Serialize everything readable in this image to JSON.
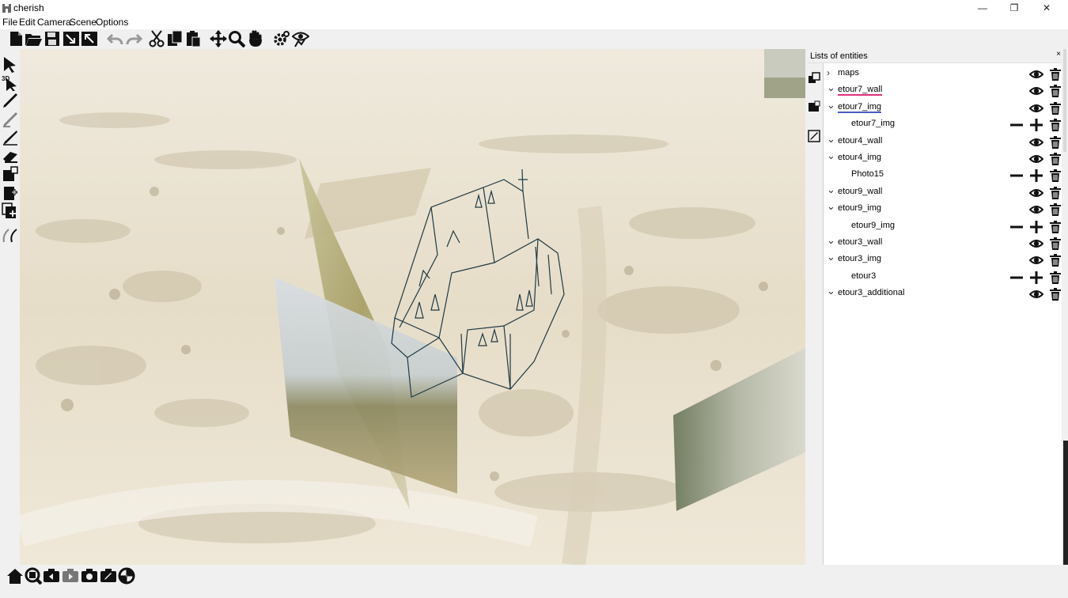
{
  "window": {
    "title": "cherish",
    "minimize": "—",
    "restore": "❐",
    "close": "✕"
  },
  "menu": [
    "File",
    "Edit",
    "Camera",
    "Scene",
    "Options"
  ],
  "toolbar_icons": [
    "new-file-icon",
    "open-folder-icon",
    "save-icon",
    "import-image-icon",
    "export-image-icon",
    "undo-icon",
    "redo-icon",
    "cut-icon",
    "copy-icon",
    "paste-icon",
    "move-icon",
    "zoom-icon",
    "pan-hand-icon",
    "settings-icon",
    "view-options-icon"
  ],
  "left_tools": [
    "select-arrow-icon",
    "select-3d-icon",
    "pen-icon",
    "pencil-faded-icon",
    "brush-icon",
    "eraser-icon",
    "add-canvas-icon",
    "new-canvas-icon",
    "clone-canvas-icon",
    "curve-icon"
  ],
  "panel": {
    "title": "Lists of entities",
    "close": "×",
    "entities": [
      {
        "name": "maps",
        "level": 0,
        "expanded": false,
        "visible": true,
        "deletable": true,
        "has_stepper": false,
        "underline": ""
      },
      {
        "name": "etour7_wall",
        "level": 0,
        "expanded": true,
        "visible": true,
        "deletable": true,
        "has_stepper": false,
        "underline": "#e0307a"
      },
      {
        "name": "etour7_img",
        "level": 0,
        "expanded": true,
        "visible": true,
        "deletable": true,
        "has_stepper": false,
        "underline": "#4a5cc8"
      },
      {
        "name": "etour7_img",
        "level": 1,
        "expanded": false,
        "visible": false,
        "deletable": true,
        "has_stepper": true,
        "underline": ""
      },
      {
        "name": "etour4_wall",
        "level": 0,
        "expanded": true,
        "visible": true,
        "deletable": true,
        "has_stepper": false,
        "underline": ""
      },
      {
        "name": "etour4_img",
        "level": 0,
        "expanded": true,
        "visible": true,
        "deletable": true,
        "has_stepper": false,
        "underline": ""
      },
      {
        "name": "Photo15",
        "level": 1,
        "expanded": false,
        "visible": false,
        "deletable": true,
        "has_stepper": true,
        "underline": ""
      },
      {
        "name": "etour9_wall",
        "level": 0,
        "expanded": true,
        "visible": true,
        "deletable": true,
        "has_stepper": false,
        "underline": ""
      },
      {
        "name": "etour9_img",
        "level": 0,
        "expanded": true,
        "visible": true,
        "deletable": true,
        "has_stepper": false,
        "underline": ""
      },
      {
        "name": "etour9_img",
        "level": 1,
        "expanded": false,
        "visible": false,
        "deletable": true,
        "has_stepper": true,
        "underline": ""
      },
      {
        "name": "etour3_wall",
        "level": 0,
        "expanded": true,
        "visible": true,
        "deletable": true,
        "has_stepper": false,
        "underline": ""
      },
      {
        "name": "etour3_img",
        "level": 0,
        "expanded": true,
        "visible": true,
        "deletable": true,
        "has_stepper": false,
        "underline": ""
      },
      {
        "name": "etour3",
        "level": 1,
        "expanded": false,
        "visible": false,
        "deletable": true,
        "has_stepper": true,
        "underline": ""
      },
      {
        "name": "etour3_additional",
        "level": 0,
        "expanded": true,
        "visible": true,
        "deletable": true,
        "has_stepper": false,
        "underline": ""
      }
    ]
  },
  "side_icons": [
    "bring-forward-icon",
    "canvas-select-icon",
    "edit-canvas-icon"
  ],
  "bottom_icons": [
    "home-view-icon",
    "zoom-fit-icon",
    "prev-bookmark-icon",
    "next-bookmark-icon",
    "camera-snapshot-icon",
    "camera-edit-icon",
    "rotate-view-icon"
  ],
  "colors": {
    "accent_pink": "#e0307a",
    "accent_blue": "#4a5cc8",
    "wireframe": "#1f3a44",
    "map_bg": "#e8e1d0"
  }
}
